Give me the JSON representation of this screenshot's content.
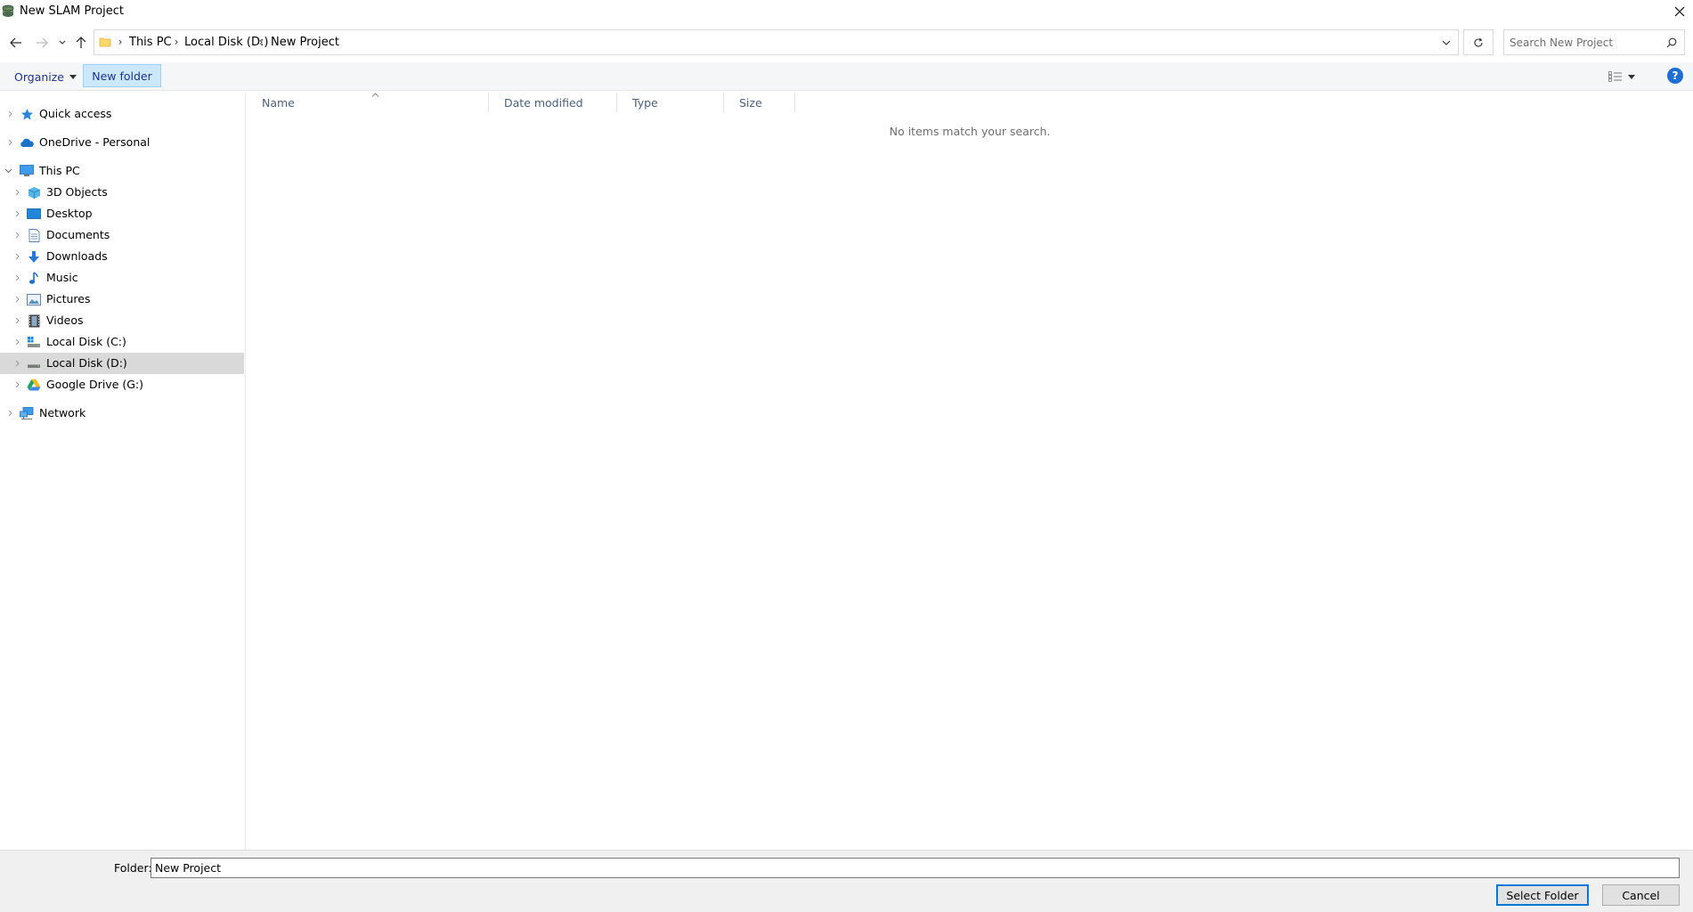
{
  "window": {
    "title": "New SLAM Project"
  },
  "address": {
    "crumbs": [
      "This PC",
      "Local Disk (D:)",
      "New Project"
    ]
  },
  "search": {
    "placeholder": "Search New Project"
  },
  "toolbar": {
    "organize_label": "Organize",
    "new_folder_label": "New folder",
    "help_label": "?"
  },
  "nav_tree": {
    "quick_access": "Quick access",
    "onedrive": "OneDrive - Personal",
    "this_pc": "This PC",
    "objects_3d": "3D Objects",
    "desktop": "Desktop",
    "documents": "Documents",
    "downloads": "Downloads",
    "music": "Music",
    "pictures": "Pictures",
    "videos": "Videos",
    "local_disk_c": "Local Disk (C:)",
    "local_disk_d": "Local Disk (D:)",
    "google_drive": "Google Drive (G:)",
    "network": "Network"
  },
  "columns": {
    "name": "Name",
    "date_modified": "Date modified",
    "type": "Type",
    "size": "Size"
  },
  "content": {
    "empty_message": "No items match your search."
  },
  "footer": {
    "folder_label": "Folder:",
    "folder_value": "New Project",
    "select_label": "Select Folder",
    "cancel_label": "Cancel"
  },
  "colors": {
    "accent": "#0078d7",
    "selected_bg": "#d9d9d9",
    "new_folder_bg": "#cce8ff",
    "header_text": "#4c607a"
  }
}
